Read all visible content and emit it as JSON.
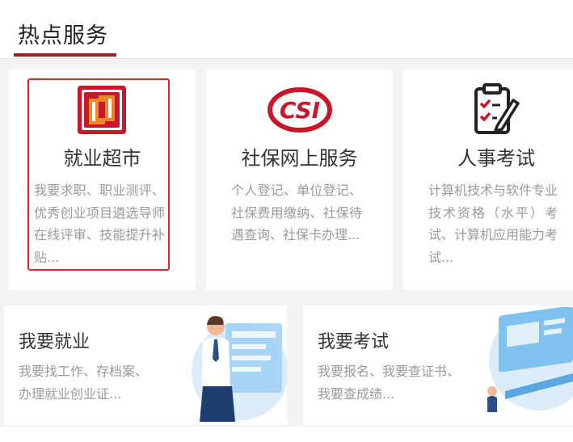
{
  "section": {
    "title": "热点服务"
  },
  "cards": [
    {
      "title": "就业超市",
      "desc": "我要求职、职业测评、优秀创业项目遴选导师在线评审、技能提升补贴...",
      "icon": "employment-market-logo-icon"
    },
    {
      "title": "社保网上服务",
      "desc": "个人登记、单位登记、社保费用缴纳、社保待遇查询、社保卡办理...",
      "icon": "social-security-logo-icon"
    },
    {
      "title": "人事考试",
      "desc": "计算机技术与软件专业技术资格（水平）考试、计算机应用能力考试...",
      "icon": "exam-clipboard-icon"
    }
  ],
  "wide_cards": [
    {
      "title": "我要就业",
      "desc_line1": "我要找工作、存档案、",
      "desc_line2": "办理就业创业证...",
      "illustration": "office-worker-illustration"
    },
    {
      "title": "我要考试",
      "desc_line1": "我要报名、我要查证书、",
      "desc_line2": "我要查成绩...",
      "illustration": "computer-exam-illustration"
    }
  ],
  "colors": {
    "accent": "#a3162b",
    "highlight": "#e8202a",
    "logo_red": "#c8162b",
    "logo_orange": "#f08a2a"
  }
}
